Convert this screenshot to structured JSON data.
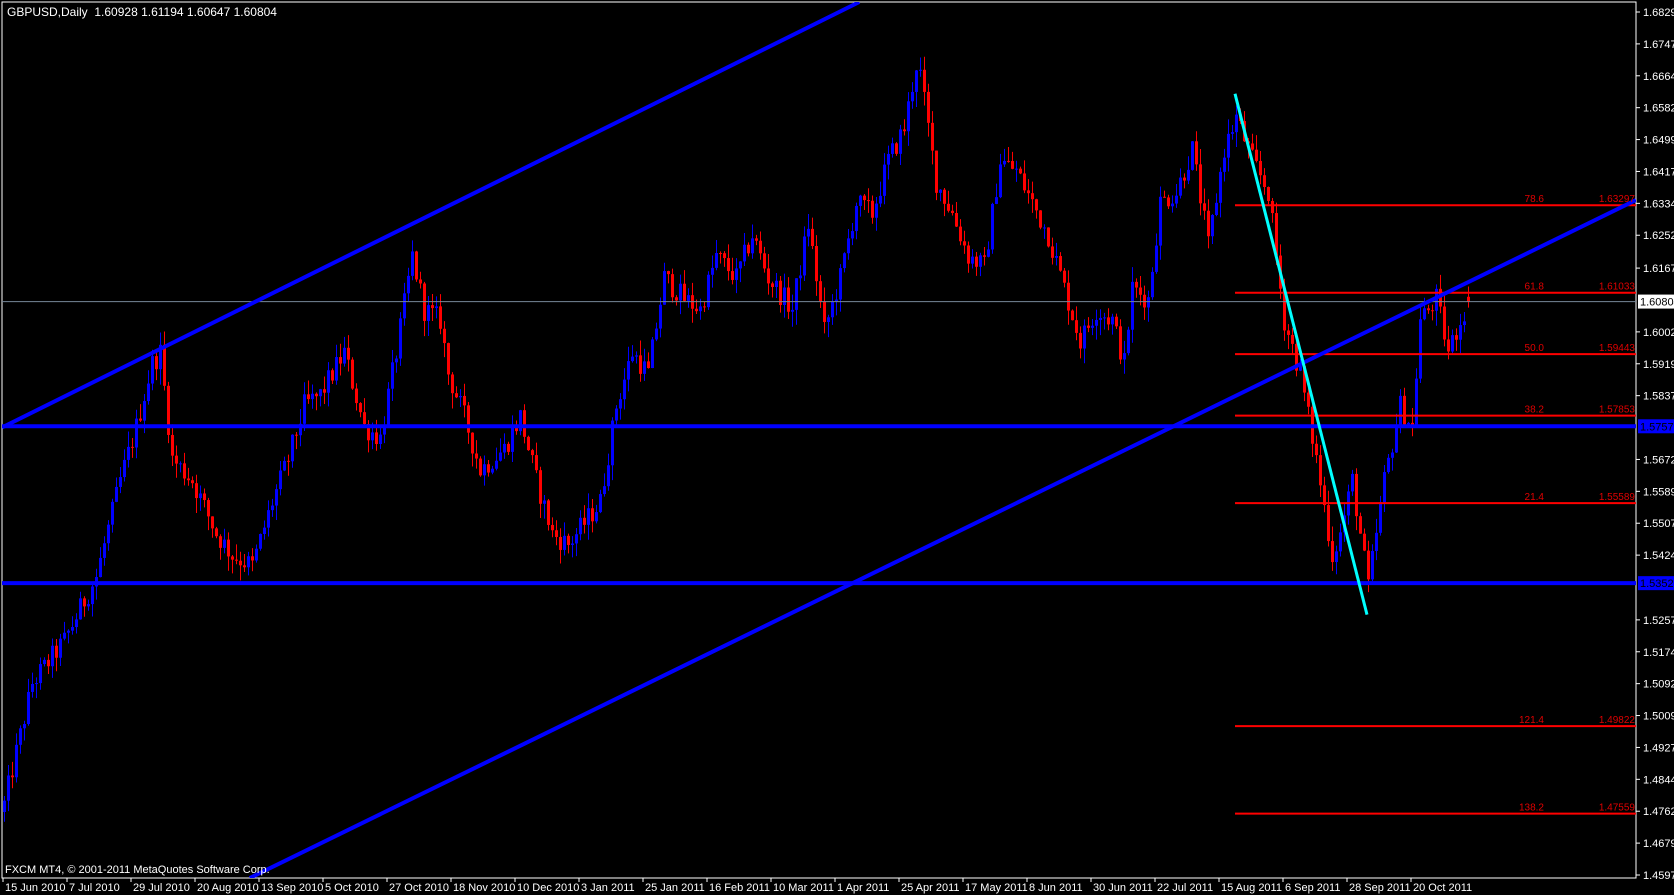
{
  "header": {
    "symbol_timeframe": "GBPUSD,Daily",
    "ohlc": "1.60928 1.61194 1.60647 1.60804"
  },
  "footer": {
    "copyright": "FXCM MT4, © 2001-2011 MetaQuotes Software Corp."
  },
  "colors": {
    "background": "#000000",
    "bull": "#0000ff",
    "bear": "#ff0000",
    "axis": "#ffffff",
    "fib": "#ff0000",
    "trend": "#0000ff",
    "cyan": "#00ffff",
    "price_line": "#778899"
  },
  "chart_data": {
    "type": "candlestick",
    "symbol": "GBPUSD",
    "timeframe": "Daily",
    "last_bar": {
      "open": 1.60928,
      "high": 1.61194,
      "low": 1.60647,
      "close": 1.60804
    },
    "ylim": [
      1.4597,
      1.68295
    ],
    "y_ticks": [
      "1.68295",
      "1.67470",
      "1.66645",
      "1.65820",
      "1.64995",
      "1.64170",
      "1.63345",
      "1.62520",
      "1.61670",
      "1.60020",
      "1.59195",
      "1.58370",
      "1.56720",
      "1.55895",
      "1.55070",
      "1.54245",
      "1.52570",
      "1.51745",
      "1.50920",
      "1.50095",
      "1.49270",
      "1.48445",
      "1.47620",
      "1.46795",
      "1.45970"
    ],
    "x_ticks": [
      "15 Jun 2010",
      "7 Jul 2010",
      "29 Jul 2010",
      "20 Aug 2010",
      "13 Sep 2010",
      "5 Oct 2010",
      "27 Oct 2010",
      "18 Nov 2010",
      "10 Dec 2010",
      "3 Jan 2011",
      "25 Jan 2011",
      "16 Feb 2011",
      "10 Mar 2011",
      "1 Apr 2011",
      "25 Apr 2011",
      "17 May 2011",
      "8 Jun 2011",
      "30 Jun 2011",
      "22 Jul 2011",
      "15 Aug 2011",
      "6 Sep 2011",
      "28 Sep 2011",
      "20 Oct 2011"
    ],
    "bars_per_x_tick": 16,
    "visible_bars": 409,
    "close_path_bar_price": [
      [
        0,
        1.478
      ],
      [
        7,
        1.5093
      ],
      [
        15,
        1.5203
      ],
      [
        23,
        1.5369
      ],
      [
        29,
        1.5618
      ],
      [
        33,
        1.5756
      ],
      [
        37,
        1.5921
      ],
      [
        39,
        1.5949
      ],
      [
        42,
        1.5673
      ],
      [
        47,
        1.5618
      ],
      [
        53,
        1.548
      ],
      [
        57,
        1.5424
      ],
      [
        62,
        1.5397
      ],
      [
        67,
        1.5562
      ],
      [
        71,
        1.5673
      ],
      [
        75,
        1.5811
      ],
      [
        79,
        1.5839
      ],
      [
        85,
        1.5949
      ],
      [
        90,
        1.5756
      ],
      [
        94,
        1.5728
      ],
      [
        98,
        1.5949
      ],
      [
        102,
        1.6198
      ],
      [
        105,
        1.606
      ],
      [
        109,
        1.6032
      ],
      [
        111,
        1.5894
      ],
      [
        115,
        1.5783
      ],
      [
        119,
        1.5645
      ],
      [
        125,
        1.57
      ],
      [
        129,
        1.5783
      ],
      [
        133,
        1.5618
      ],
      [
        137,
        1.548
      ],
      [
        141,
        1.5452
      ],
      [
        145,
        1.5507
      ],
      [
        149,
        1.5562
      ],
      [
        153,
        1.5811
      ],
      [
        157,
        1.5949
      ],
      [
        161,
        1.5894
      ],
      [
        165,
        1.6142
      ],
      [
        170,
        1.6087
      ],
      [
        174,
        1.606
      ],
      [
        178,
        1.6198
      ],
      [
        183,
        1.6142
      ],
      [
        187,
        1.6253
      ],
      [
        191,
        1.6142
      ],
      [
        197,
        1.606
      ],
      [
        201,
        1.6281
      ],
      [
        205,
        1.6004
      ],
      [
        209,
        1.6142
      ],
      [
        213,
        1.6336
      ],
      [
        217,
        1.6308
      ],
      [
        221,
        1.6446
      ],
      [
        225,
        1.6529
      ],
      [
        228,
        1.6695
      ],
      [
        229,
        1.6667
      ],
      [
        233,
        1.6391
      ],
      [
        237,
        1.6308
      ],
      [
        241,
        1.6198
      ],
      [
        245,
        1.617
      ],
      [
        249,
        1.6446
      ],
      [
        253,
        1.6419
      ],
      [
        257,
        1.6336
      ],
      [
        261,
        1.6253
      ],
      [
        265,
        1.6115
      ],
      [
        269,
        1.5977
      ],
      [
        273,
        1.606
      ],
      [
        277,
        1.6032
      ],
      [
        280,
        1.5921
      ],
      [
        282,
        1.6115
      ],
      [
        286,
        1.6087
      ],
      [
        289,
        1.6336
      ],
      [
        293,
        1.6364
      ],
      [
        297,
        1.6474
      ],
      [
        301,
        1.6225
      ],
      [
        305,
        1.6474
      ],
      [
        308,
        1.6557
      ],
      [
        312,
        1.6446
      ],
      [
        316,
        1.6364
      ],
      [
        320,
        1.6032
      ],
      [
        324,
        1.5894
      ],
      [
        328,
        1.5673
      ],
      [
        332,
        1.5424
      ],
      [
        334,
        1.548
      ],
      [
        337,
        1.5618
      ],
      [
        341,
        1.5341
      ],
      [
        345,
        1.5618
      ],
      [
        349,
        1.5811
      ],
      [
        352,
        1.5756
      ],
      [
        354,
        1.6032
      ],
      [
        358,
        1.6087
      ],
      [
        361,
        1.5949
      ],
      [
        364,
        1.6032
      ],
      [
        366,
        1.60804
      ]
    ],
    "current_price": "1.60804",
    "horizontal_lines": [
      {
        "price": 1.57578,
        "label": "1.57578"
      },
      {
        "price": 1.5352,
        "label": "1.53520"
      }
    ],
    "trendlines": [
      {
        "name": "upper-channel",
        "from": [
          0,
          1.5756
        ],
        "to": [
          214,
          1.6855
        ],
        "color": "#0000ff"
      },
      {
        "name": "lower-channel",
        "from": [
          0,
          1.4277
        ],
        "to": [
          408.25,
          1.6343
        ],
        "color": "#0000ff"
      },
      {
        "name": "fib-swing",
        "from": [
          308,
          1.66181
        ],
        "to": [
          341,
          1.52706
        ],
        "color": "#00ffff"
      }
    ],
    "fibonacci": {
      "start_bar": 308,
      "levels": [
        {
          "level": "78.6",
          "price": "1.63297"
        },
        {
          "level": "61.8",
          "price": "1.61033"
        },
        {
          "level": "50.0",
          "price": "1.59443"
        },
        {
          "level": "38.2",
          "price": "1.57853"
        },
        {
          "level": "21.4",
          "price": "1.55589"
        },
        {
          "level": "121.4",
          "price": "1.49822"
        },
        {
          "level": "138.2",
          "price": "1.47559"
        }
      ]
    }
  }
}
